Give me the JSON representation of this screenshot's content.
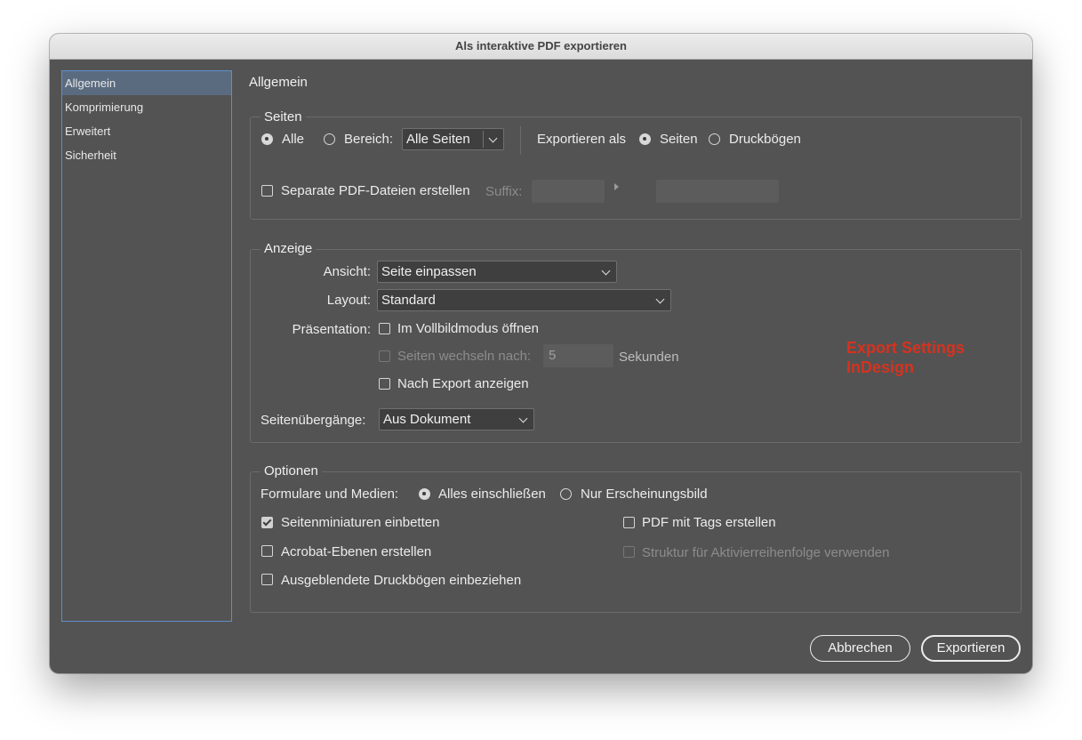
{
  "window": {
    "title": "Als interaktive PDF exportieren"
  },
  "sidebar": {
    "items": [
      {
        "label": "Allgemein"
      },
      {
        "label": "Komprimierung"
      },
      {
        "label": "Erweitert"
      },
      {
        "label": "Sicherheit"
      }
    ]
  },
  "main": {
    "heading": "Allgemein"
  },
  "seiten": {
    "legend": "Seiten",
    "alle_label": "Alle",
    "bereich_label": "Bereich:",
    "bereich_value": "Alle Seiten",
    "exportieren_als_label": "Exportieren als",
    "seiten_label": "Seiten",
    "druckboegen_label": "Druckbögen",
    "separate_label": "Separate PDF-Dateien erstellen",
    "suffix_label": "Suffix:"
  },
  "anzeige": {
    "legend": "Anzeige",
    "ansicht_label": "Ansicht:",
    "ansicht_value": "Seite einpassen",
    "layout_label": "Layout:",
    "layout_value": "Standard",
    "praesentation_label": "Präsentation:",
    "vollbild_label": "Im Vollbildmodus öffnen",
    "wechseln_label": "Seiten wechseln nach:",
    "wechseln_value": "5",
    "sekunden_label": "Sekunden",
    "nach_export_label": "Nach Export anzeigen",
    "uebergaenge_label": "Seitenübergänge:",
    "uebergaenge_value": "Aus Dokument"
  },
  "optionen": {
    "legend": "Optionen",
    "formulare_label": "Formulare und Medien:",
    "alles_label": "Alles einschließen",
    "nur_label": "Nur Erscheinungsbild",
    "miniaturen_label": "Seitenminiaturen einbetten",
    "acrobat_label": "Acrobat-Ebenen erstellen",
    "ausgeblendet_label": "Ausgeblendete Druckbögen einbeziehen",
    "tags_label": "PDF mit Tags erstellen",
    "struktur_label": "Struktur für Aktivierreihenfolge verwenden"
  },
  "annotation": {
    "line1": "Export Settings",
    "line2": "InDesign",
    "color": "#d6321f"
  },
  "buttons": {
    "cancel": "Abbrechen",
    "export": "Exportieren"
  }
}
